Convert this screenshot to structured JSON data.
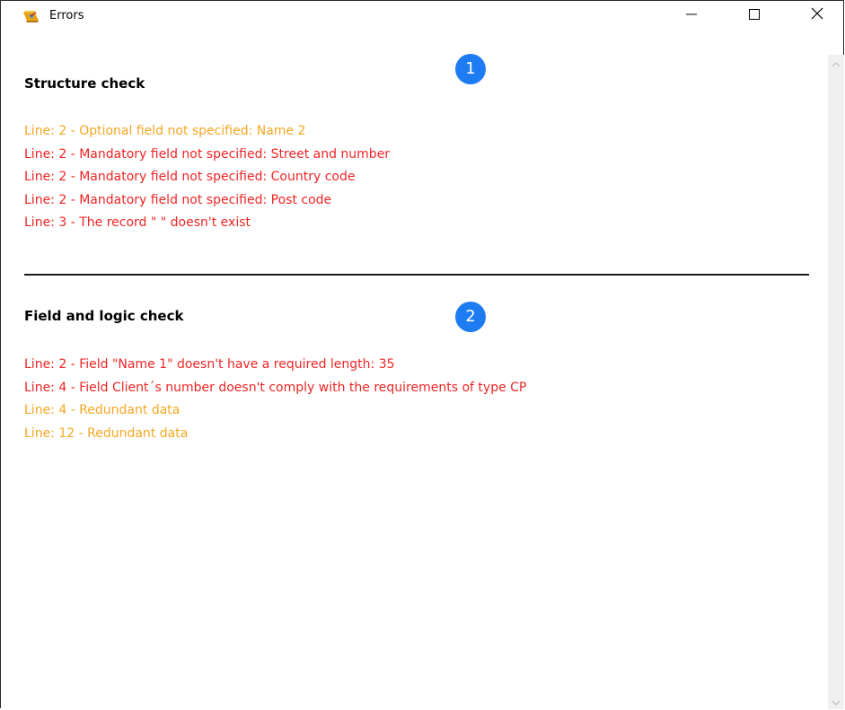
{
  "window": {
    "title": "Errors",
    "controls": {
      "minimize": "minimize-icon",
      "maximize": "maximize-icon",
      "close": "close-icon"
    }
  },
  "colors": {
    "error": "#f02525",
    "warning": "#f5a623",
    "badge": "#1e7cf2"
  },
  "sections": [
    {
      "title": "Structure check",
      "badge": "1",
      "messages": [
        {
          "text": "Line: 2 - Optional field not specified: Name 2",
          "level": "warning"
        },
        {
          "text": "Line: 2 - Mandatory field not specified: Street and number",
          "level": "error"
        },
        {
          "text": "Line: 2 - Mandatory field not specified: Country code",
          "level": "error"
        },
        {
          "text": "Line: 2 - Mandatory field not specified: Post code",
          "level": "error"
        },
        {
          "text": "Line: 3 - The record \" \" doesn't exist",
          "level": "error"
        }
      ]
    },
    {
      "title": "Field and logic check",
      "badge": "2",
      "messages": [
        {
          "text": "Line: 2 - Field \"Name 1\" doesn't have a required length: 35",
          "level": "error"
        },
        {
          "text": "Line: 4 - Field Client´s number doesn't comply with the requirements of type CP",
          "level": "error"
        },
        {
          "text": "Line: 4 - Redundant data",
          "level": "warning"
        },
        {
          "text": "Line: 12 - Redundant data",
          "level": "warning"
        }
      ]
    }
  ]
}
